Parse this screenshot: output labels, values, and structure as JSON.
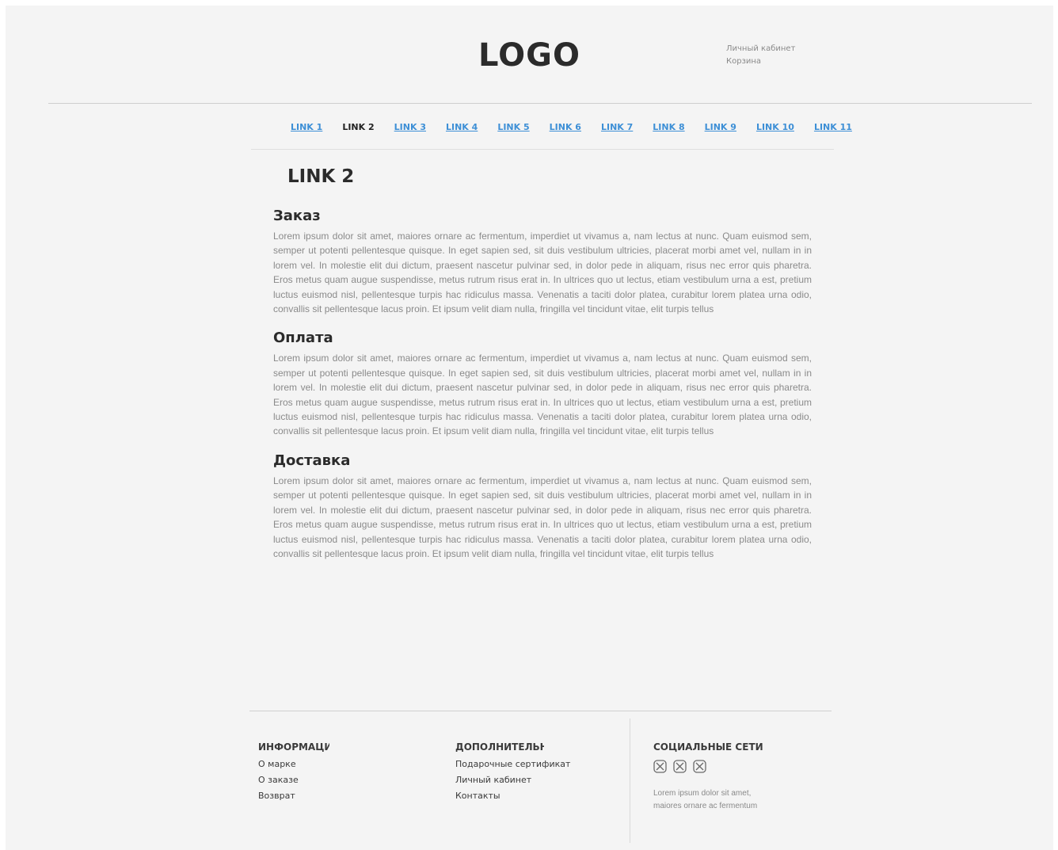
{
  "header": {
    "logo": "LOGO",
    "account_link": "Личный кабинет",
    "cart_link": "Корзина"
  },
  "nav": {
    "links": [
      "LINK 1",
      "LINK 2",
      "LINK 3",
      "LINK 4",
      "LINK 5",
      "LINK 6",
      "LINK 7",
      "LINK 8",
      "LINK 9",
      "LINK 10",
      "LINK 11"
    ],
    "active_index": 1
  },
  "main": {
    "title": "LINK 2",
    "sections": [
      {
        "heading": "Заказ",
        "text": "Lorem ipsum dolor sit amet, maiores ornare ac fermentum, imperdiet ut vivamus a, nam lectus at nunc. Quam euismod sem, semper ut potenti pellentesque quisque. In eget sapien sed, sit duis vestibulum ultricies, placerat morbi amet vel, nullam in in lorem vel. In molestie elit dui dictum, praesent nascetur pulvinar sed, in dolor pede in aliquam, risus nec error quis pharetra. Eros metus quam augue suspendisse, metus rutrum risus erat in.  In ultrices quo ut lectus, etiam vestibulum urna a est, pretium luctus euismod nisl, pellentesque turpis hac ridiculus massa. Venenatis a taciti dolor platea, curabitur lorem platea urna odio, convallis sit pellentesque lacus proin. Et ipsum velit diam nulla, fringilla vel tincidunt vitae, elit turpis tellus"
      },
      {
        "heading": "Оплата",
        "text": "Lorem ipsum dolor sit amet, maiores ornare ac fermentum, imperdiet ut vivamus a, nam lectus at nunc. Quam euismod sem, semper ut potenti pellentesque quisque. In eget sapien sed, sit duis vestibulum ultricies, placerat morbi amet vel, nullam in in lorem vel. In molestie elit dui dictum, praesent nascetur pulvinar sed, in dolor pede in aliquam, risus nec error quis pharetra. Eros metus quam augue suspendisse, metus rutrum risus erat in.  In ultrices quo ut lectus, etiam vestibulum urna a est, pretium luctus euismod nisl, pellentesque turpis hac ridiculus massa. Venenatis a taciti dolor platea, curabitur lorem platea urna odio, convallis sit pellentesque lacus proin. Et ipsum velit diam nulla, fringilla vel tincidunt vitae, elit turpis tellus"
      },
      {
        "heading": "Доставка",
        "text": "Lorem ipsum dolor sit amet, maiores ornare ac fermentum, imperdiet ut vivamus a, nam lectus at nunc. Quam euismod sem, semper ut potenti pellentesque quisque. In eget sapien sed, sit duis vestibulum ultricies, placerat morbi amet vel, nullam in in lorem vel. In molestie elit dui dictum, praesent nascetur pulvinar sed, in dolor pede in aliquam, risus nec error quis pharetra. Eros metus quam augue suspendisse, metus rutrum risus erat in.  In ultrices quo ut lectus, etiam vestibulum urna a est, pretium luctus euismod nisl, pellentesque turpis hac ridiculus massa. Venenatis a taciti dolor platea, curabitur lorem platea urna odio, convallis sit pellentesque lacus proin. Et ipsum velit diam nulla, fringilla vel tincidunt vitae, elit turpis tellus"
      }
    ]
  },
  "footer": {
    "info": {
      "heading": "ИНФОРМАЦИЯ",
      "items": [
        "О марке",
        "О заказе",
        "Возврат"
      ]
    },
    "extra": {
      "heading": "ДОПОЛНИТЕЛЬНО",
      "items": [
        "Подарочные сертификаты",
        "Личный кабинет",
        "Контакты"
      ]
    },
    "social": {
      "heading": "СОЦИАЛЬНЫЕ СЕТИ",
      "icons": [
        "social-icon-1",
        "social-icon-2",
        "social-icon-3"
      ],
      "text": "Lorem ipsum dolor sit amet, maiores ornare ac fermentum"
    }
  },
  "colors": {
    "page_background": "#f4f4f4",
    "link": "#3d8fd6",
    "body_text": "#8a8a8a",
    "heading_text": "#2b2b2b"
  }
}
